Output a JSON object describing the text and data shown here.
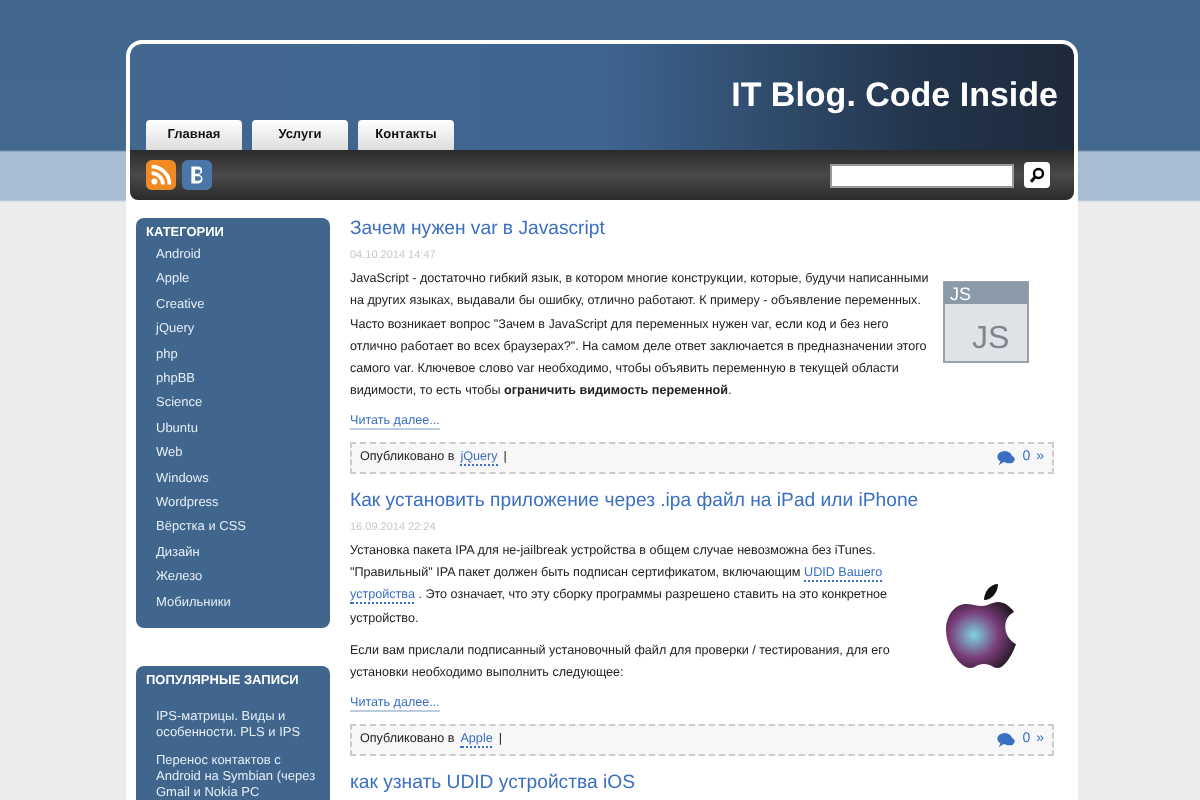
{
  "header": {
    "title": "IT Blog. Code Inside"
  },
  "tabs": [
    {
      "label": "Главная",
      "selected": false
    },
    {
      "label": "Услуги",
      "selected": false
    },
    {
      "label": "Контакты",
      "selected": false
    }
  ],
  "sidebar": {
    "categories": {
      "title": "КАТЕГОРИИ",
      "items": [
        "Android",
        "Apple",
        "Creative",
        "jQuery",
        "php",
        "phpBB",
        "Science",
        "Ubuntu",
        "Web",
        "Windows",
        "Wordpress",
        "Вёрстка и CSS",
        "Дизайн",
        "Железо",
        "Мобильники"
      ]
    },
    "popular": {
      "title": "ПОПУЛЯРНЫЕ ЗАПИСИ",
      "items": [
        "IPS-матрицы. Виды и особенности. PLS и IPS",
        "Перенос контактов с Android на Symbian (через Gmail и Nokia PC"
      ]
    }
  },
  "posts": [
    {
      "title": "Зачем нужен var в Javascript",
      "date": "04.10.2014 14:47",
      "kind": "file-icon",
      "thumb_texts": [
        "JS",
        "JS"
      ],
      "paragraphs": [
        [
          {
            "kind": "text",
            "text": "JavaScript - достаточно гибкий язык, в котором многие конструкции, которые, будучи написанными на других языках, выдавали бы ошибку, отлично работают. К примеру - объявление переменных. Часто возникает вопрос \"Зачем в JavaScript  для переменных нужен var, если код и без него отлично работает во всех браузерах?\". На самом деле ответ заключается в предназначении этого самого var. Ключевое слово var необходимо, чтобы объявить переменную  в текущей области видимости, то есть чтобы **ограничить видимость переменной**."
          }
        ]
      ],
      "read_more": "Читать далее...",
      "published": "Опубликовано в",
      "category": "jQuery",
      "separator": "|",
      "comments": "0",
      "more": "»"
    },
    {
      "title": "Как установить приложение через .ipa файл на iPad или iPhone",
      "date": "16.09.2014 22:24",
      "kind": "logo",
      "paragraphs": [
        [
          {
            "kind": "text",
            "text": "Установка пакета IPA  для не-jailbreak устройства в общем случае невозможна без iTunes. \"Правильный\" IPA пакет должен быть подписан сертификатом, включающим"
          },
          {
            "kind": "link",
            "text": "UDID Вашего"
          },
          {
            "kind": "link",
            "text": "устройства"
          },
          {
            "kind": "text",
            "text": ". Это означает, что эту сборку программы разрешено ставить на это конкретное устройство."
          }
        ],
        [
          {
            "kind": "text",
            "text": "Если вам прислали подписанный установочный файл для проверки / тестирования, для его установки необходимо выполнить следующее:"
          }
        ]
      ],
      "read_more": "Читать далее...",
      "published": "Опубликовано в",
      "category": "Apple",
      "separator": "|",
      "comments": "0",
      "more": "»"
    },
    {
      "title": "как узнать UDID устройства iOS"
    }
  ]
}
